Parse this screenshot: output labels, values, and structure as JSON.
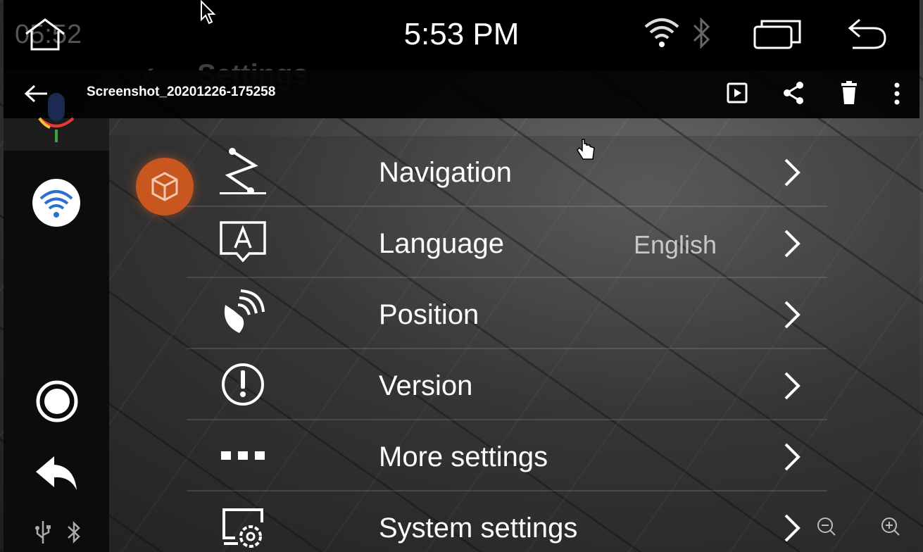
{
  "status_bar": {
    "time": "5:53 PM",
    "ghost_clock": "05:52",
    "icons": [
      "home-icon",
      "wifi-icon",
      "bluetooth-icon",
      "recent-apps-icon",
      "back-icon"
    ]
  },
  "background_app": {
    "title": "Settings"
  },
  "viewer": {
    "filename": "Screenshot_20201226-175258",
    "actions": [
      "play-icon",
      "share-icon",
      "delete-icon",
      "more-vert-icon"
    ]
  },
  "sidebar": {
    "items": [
      "mic-icon",
      "wifi-icon",
      "record-icon",
      "back-arrow-icon",
      "usb-icon",
      "bluetooth-icon"
    ]
  },
  "menu": {
    "items": [
      {
        "label": "Navigation",
        "value": "",
        "icon": "navigation-route-icon"
      },
      {
        "label": "Language",
        "value": "English",
        "icon": "language-icon"
      },
      {
        "label": "Position",
        "value": "",
        "icon": "satellite-dish-icon"
      },
      {
        "label": "Version",
        "value": "",
        "icon": "info-exclamation-icon"
      },
      {
        "label": "More settings",
        "value": "",
        "icon": "dots-icon"
      },
      {
        "label": "System settings",
        "value": "",
        "icon": "system-gear-icon"
      }
    ]
  },
  "colors": {
    "accent": "#c8561f",
    "wifi_blue": "#2a6fd6"
  }
}
